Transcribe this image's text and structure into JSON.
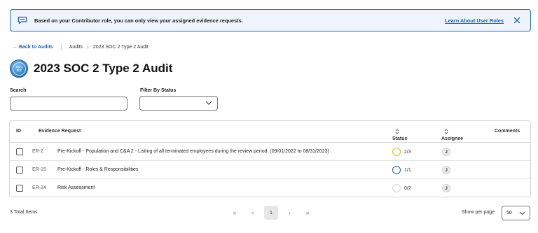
{
  "banner": {
    "message": "Based on your Contributor role, you can only view your assigned evidence requests.",
    "link_label": "Learn About User Roles",
    "color": "#2f6ab1"
  },
  "breadcrumb": {
    "back_label": "← Back to Audits",
    "items": [
      "Audits",
      "2023 SOC 2 Type 2 Audit"
    ]
  },
  "page": {
    "title": "2023 SOC 2 Type 2 Audit",
    "logo_text": "AICPA SOC"
  },
  "filters": {
    "search_label": "Search",
    "search_value": "",
    "status_label": "Filter By Status",
    "status_value": ""
  },
  "table": {
    "columns": [
      "ID",
      "Evidence Request",
      "Status",
      "Assignee",
      "Comments"
    ],
    "rows": [
      {
        "id": "ER-2",
        "request": "Pre-Kickoff - Population and C&A 2 - Listing of all terminated employees during the review period. (09/01/2022 to 08/31/2023)",
        "status": "2/3",
        "status_color": "#e3b526",
        "assignee": "J"
      },
      {
        "id": "ER-15",
        "request": "Pre-Kickoff - Roles & Responsibilities",
        "status": "1/1",
        "status_color": "#1f5fb0",
        "assignee": "J"
      },
      {
        "id": "ER-24",
        "request": "Risk Assessment",
        "status": "0/2",
        "status_color": "#d5d5d5",
        "assignee": "J"
      }
    ]
  },
  "footer": {
    "total": "3 Total Items",
    "current_page": "1",
    "per_page_label": "Show per page",
    "per_page_value": "50"
  }
}
